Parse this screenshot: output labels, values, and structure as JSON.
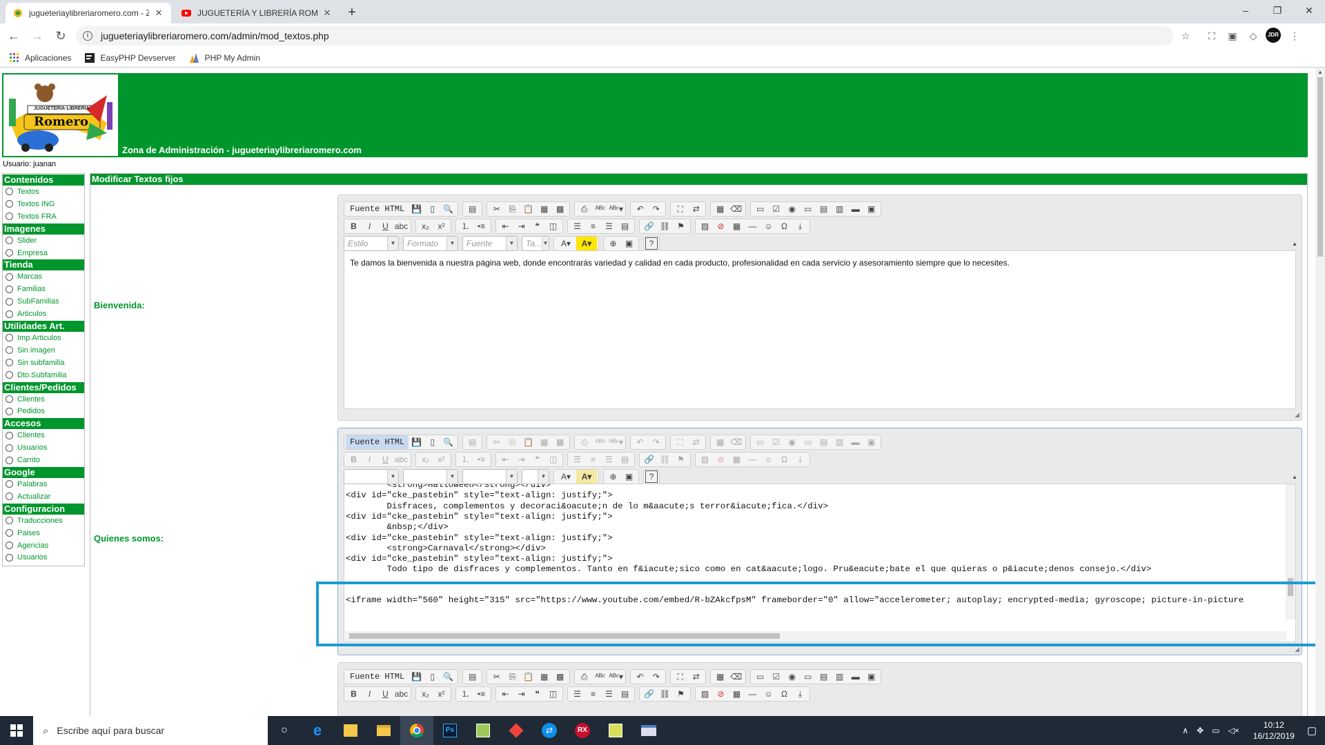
{
  "browser": {
    "tabs": [
      {
        "title": "jugueteriaylibreriaromero.com - Z"
      },
      {
        "title": "JUGUETERÍA Y LIBRERÍA ROMERO"
      }
    ],
    "url": "jugueteriaylibreriaromero.com/admin/mod_textos.php",
    "avatar_text": "JDR",
    "bookmarks": [
      "Aplicaciones",
      "EasyPHP Devserver",
      "PHP My Admin"
    ]
  },
  "header": {
    "title": "Zona de Administración - jugueteriaylibreriaromero.com",
    "logo_text_top": "JUGUETERÍA·LIBRERÍA",
    "logo_text_main": "Romero"
  },
  "user_line": "Usuario: juanan",
  "sidebar": [
    {
      "section": "Contenidos",
      "items": [
        "Textos",
        "Textos ING",
        "Textos FRA"
      ]
    },
    {
      "section": "Imagenes",
      "items": [
        "Slider",
        "Empresa"
      ]
    },
    {
      "section": "Tienda",
      "items": [
        "Marcas",
        "Familias",
        "SubFamilias",
        "Articulos"
      ]
    },
    {
      "section": "Utilidades Art.",
      "items": [
        "Imp.Articulos",
        "Sin imagen",
        "Sin subfamilia",
        "Dto.Subfamilia"
      ]
    },
    {
      "section": "Clientes/Pedidos",
      "items": [
        "Clientes",
        "Pedidos"
      ]
    },
    {
      "section": "Accesos",
      "items": [
        "Clientes",
        "Usuarios",
        "Carrito"
      ]
    },
    {
      "section": "Google",
      "items": [
        "Palabras",
        "Actualizar"
      ]
    },
    {
      "section": "Configuracion",
      "items": [
        "Traducciones",
        "Paises",
        "Agencias",
        "Usuarios"
      ]
    }
  ],
  "main": {
    "title": "Modificar Textos fijos",
    "fields": [
      {
        "label": "Bienvenida:"
      },
      {
        "label": "Quienes somos:"
      }
    ]
  },
  "editor": {
    "source_label": "Fuente HTML",
    "combos": [
      "Estilo",
      "Formato",
      "Fuente",
      "Ta..."
    ],
    "welcome_text": "Te damos la bienvenida a nuestra página web, donde encontrarás variedad y calidad en cada producto, profesionalidad en cada servicio y asesoramiento siempre que lo necesites.",
    "source_lines": [
      "        <strong>Halloween</strong></div>",
      "<div id=\"cke_pastebin\" style=\"text-align: justify;\">",
      "        Disfraces, complementos y decoraci&oacute;n de lo m&aacute;s terror&iacute;fica.</div>",
      "<div id=\"cke_pastebin\" style=\"text-align: justify;\">",
      "        &nbsp;</div>",
      "<div id=\"cke_pastebin\" style=\"text-align: justify;\">",
      "        <strong>Carnaval</strong></div>",
      "<div id=\"cke_pastebin\" style=\"text-align: justify;\">",
      "        Todo tipo de disfraces y complementos. Tanto en f&iacute;sico como en cat&aacute;logo. Pru&eacute;bate el que quieras o p&iacute;denos consejo.</div>",
      "",
      "<iframe width=\"560\" height=\"315\" src=\"https://www.youtube.com/embed/R-bZAkcfpsM\" frameborder=\"0\" allow=\"accelerometer; autoplay; encrypted-media; gyroscope; picture-in-picture"
    ]
  },
  "taskbar": {
    "search_placeholder": "Escribe aquí para buscar",
    "time": "10:12",
    "date": "16/12/2019"
  },
  "colors": {
    "brand_green": "#00962d",
    "highlight_blue": "#1d9ad6"
  }
}
